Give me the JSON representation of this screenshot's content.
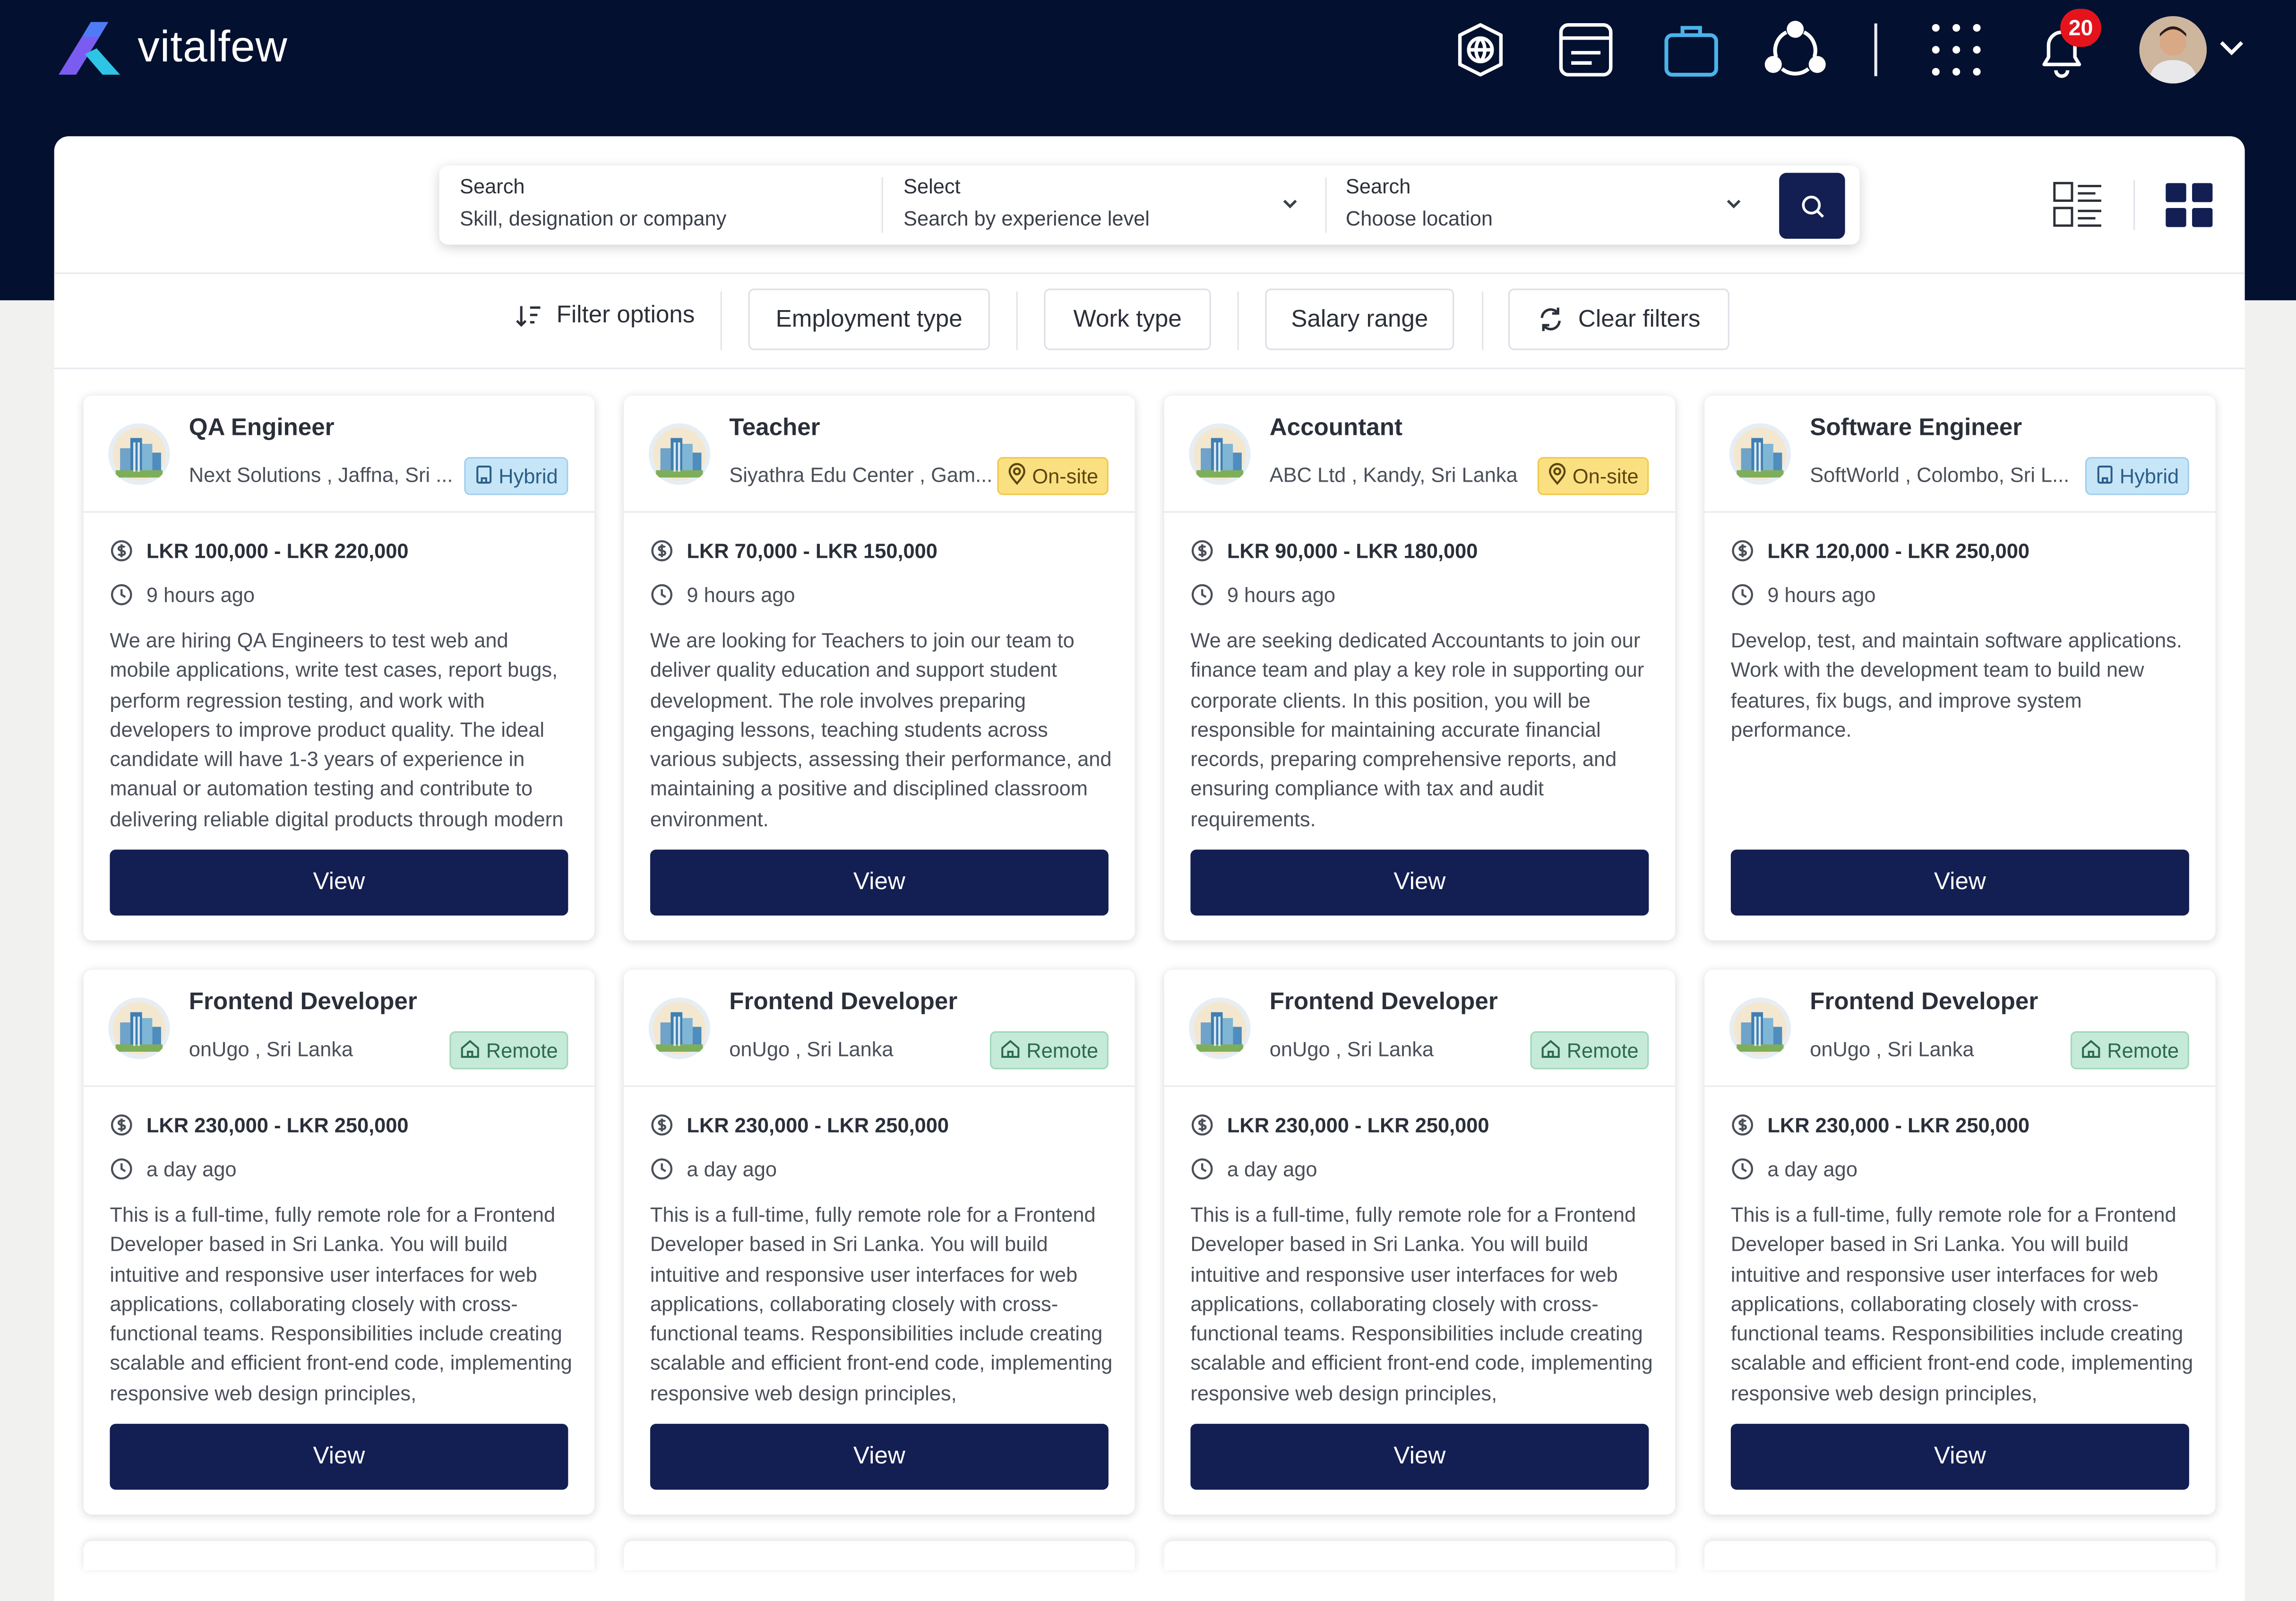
{
  "brand": {
    "name": "vitalfew"
  },
  "nav": {
    "icons": [
      "globe-icon",
      "document-icon",
      "briefcase-icon",
      "network-icon",
      "apps-grid-icon",
      "bell-icon"
    ],
    "notifications_count": "20"
  },
  "search": {
    "keyword": {
      "label": "Search",
      "placeholder": "Skill, designation or company"
    },
    "experience": {
      "label": "Select",
      "placeholder": "Search by experience level"
    },
    "location": {
      "label": "Search",
      "placeholder": "Choose location"
    }
  },
  "filters": {
    "filter_options": "Filter options",
    "employment_type": "Employment type",
    "work_type": "Work type",
    "salary_range": "Salary range",
    "clear_filters": "Clear filters"
  },
  "colors": {
    "navy": "#04102f",
    "button": "#131f52",
    "hybrid": "#c6e6f8",
    "onsite": "#fbe082",
    "remote": "#c6ead8"
  },
  "jobs": [
    {
      "title": "QA Engineer",
      "company": "Next Solutions , Jaffna, Sri ...",
      "work_type": "Hybrid",
      "salary": "LKR 100,000 - LKR 220,000",
      "posted": "9 hours ago",
      "description": "We are hiring QA Engineers to test web and mobile applications, write test cases, report bugs, perform regression testing, and work with developers to improve product quality. The ideal candidate will have 1-3 years of experience in manual or automation testing and contribute to delivering reliable digital products through modern",
      "view_label": "View"
    },
    {
      "title": "Teacher",
      "company": "Siyathra Edu Center , Gam...",
      "work_type": "On-site",
      "salary": "LKR 70,000 - LKR 150,000",
      "posted": "9 hours ago",
      "description": "We are looking for Teachers to join our team to deliver quality education and support student development. The role involves preparing engaging lessons, teaching students across various subjects, assessing their performance, and maintaining a positive and disciplined classroom environment.",
      "view_label": "View"
    },
    {
      "title": "Accountant",
      "company": "ABC Ltd , Kandy, Sri Lanka",
      "work_type": "On-site",
      "salary": "LKR 90,000 - LKR 180,000",
      "posted": "9 hours ago",
      "description": "We are seeking dedicated Accountants to join our finance team and play a key role in supporting our corporate clients. In this position, you will be responsible for maintaining accurate financial records, preparing comprehensive reports, and ensuring compliance with tax and audit requirements.",
      "view_label": "View"
    },
    {
      "title": "Software Engineer",
      "company": "SoftWorld , Colombo, Sri L...",
      "work_type": "Hybrid",
      "salary": "LKR 120,000 - LKR 250,000",
      "posted": "9 hours ago",
      "description": "Develop, test, and maintain software applications. Work with the development team to build new features, fix bugs, and improve system performance.",
      "view_label": "View"
    },
    {
      "title": "Frontend Developer",
      "company": "onUgo , Sri Lanka",
      "work_type": "Remote",
      "salary": "LKR 230,000 - LKR 250,000",
      "posted": "a day ago",
      "description": "This is a full-time, fully remote role for a Frontend Developer based in Sri Lanka. You will build intuitive and responsive user interfaces for web applications, collaborating closely with cross-functional teams. Responsibilities include creating scalable and efficient front-end code, implementing responsive web design principles,",
      "view_label": "View"
    },
    {
      "title": "Frontend Developer",
      "company": "onUgo , Sri Lanka",
      "work_type": "Remote",
      "salary": "LKR 230,000 - LKR 250,000",
      "posted": "a day ago",
      "description": "This is a full-time, fully remote role for a Frontend Developer based in Sri Lanka. You will build intuitive and responsive user interfaces for web applications, collaborating closely with cross-functional teams. Responsibilities include creating scalable and efficient front-end code, implementing responsive web design principles,",
      "view_label": "View"
    },
    {
      "title": "Frontend Developer",
      "company": "onUgo , Sri Lanka",
      "work_type": "Remote",
      "salary": "LKR 230,000 - LKR 250,000",
      "posted": "a day ago",
      "description": "This is a full-time, fully remote role for a Frontend Developer based in Sri Lanka. You will build intuitive and responsive user interfaces for web applications, collaborating closely with cross-functional teams. Responsibilities include creating scalable and efficient front-end code, implementing responsive web design principles,",
      "view_label": "View"
    },
    {
      "title": "Frontend Developer",
      "company": "onUgo , Sri Lanka",
      "work_type": "Remote",
      "salary": "LKR 230,000 - LKR 250,000",
      "posted": "a day ago",
      "description": "This is a full-time, fully remote role for a Frontend Developer based in Sri Lanka. You will build intuitive and responsive user interfaces for web applications, collaborating closely with cross-functional teams. Responsibilities include creating scalable and efficient front-end code, implementing responsive web design principles,",
      "view_label": "View"
    }
  ]
}
